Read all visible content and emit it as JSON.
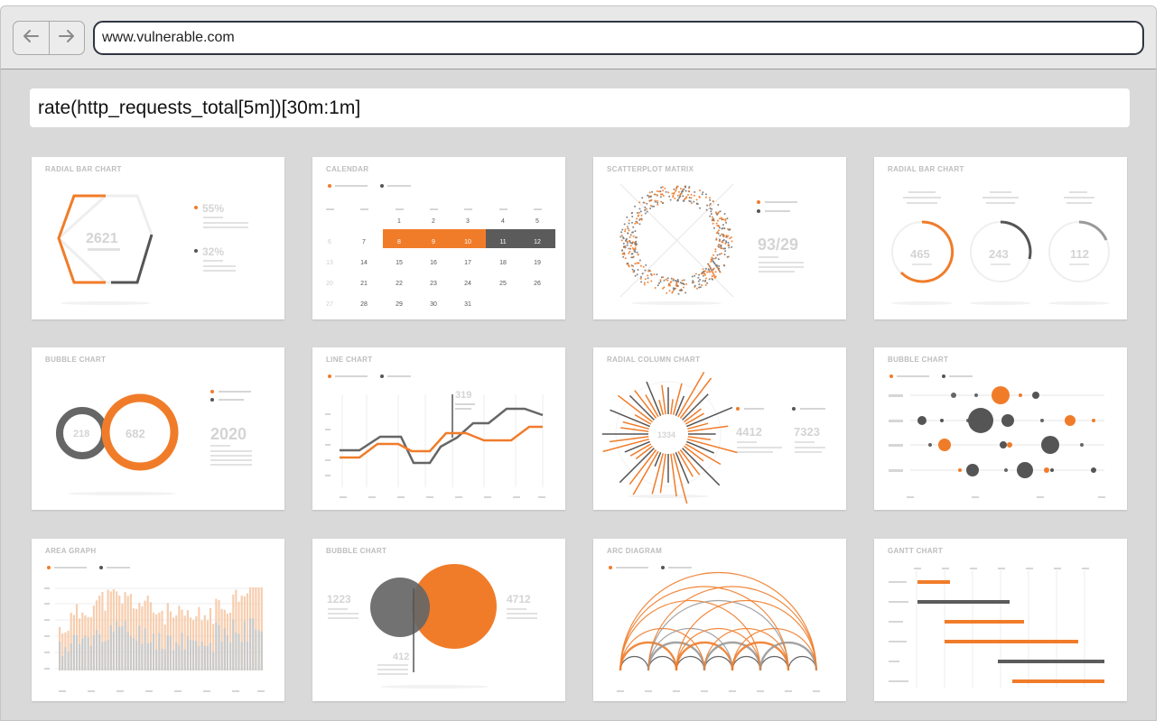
{
  "browser": {
    "url": "www.vulnerable.com",
    "back_icon": "arrow-left-icon",
    "forward_icon": "arrow-right-icon"
  },
  "query": {
    "text": "rate(http_requests_total[5m])[30m:1m]"
  },
  "cards": {
    "radial_bar": {
      "title": "RADIAL BAR CHART",
      "value": "2621",
      "pct1": "55%",
      "pct2": "32%"
    },
    "calendar": {
      "title": "CALENDAR",
      "weeks": [
        [
          "",
          "",
          "1",
          "2",
          "3",
          "4",
          "5"
        ],
        [
          "6",
          "7",
          "8",
          "9",
          "10",
          "11",
          "12"
        ],
        [
          "13",
          "14",
          "15",
          "16",
          "17",
          "18",
          "19"
        ],
        [
          "20",
          "21",
          "22",
          "23",
          "24",
          "25",
          "26"
        ],
        [
          "27",
          "28",
          "29",
          "30",
          "31",
          "",
          ""
        ]
      ]
    },
    "scatterplot": {
      "title": "SCATTERPLOT MATRIX",
      "value": "93/29"
    },
    "radial_bar2": {
      "title": "RADIAL BAR CHART",
      "v1": "465",
      "v2": "243",
      "v3": "112"
    },
    "bubble1": {
      "title": "BUBBLE CHART",
      "v1": "218",
      "v2": "682",
      "v3": "2020"
    },
    "line": {
      "title": "LINE CHART",
      "value": "319"
    },
    "radial_column": {
      "title": "RADIAL COLUMN CHART",
      "center": "1334",
      "v1": "4412",
      "v2": "7323"
    },
    "bubble2": {
      "title": "BUBBLE CHART"
    },
    "area": {
      "title": "AREA GRAPH"
    },
    "bubble3": {
      "title": "BUBBLE CHART",
      "v1": "1223",
      "v2": "4712",
      "v3": "412"
    },
    "arc": {
      "title": "ARC DIAGRAM"
    },
    "gantt": {
      "title": "GANTT CHART"
    }
  },
  "colors": {
    "accent": "#f07c2a",
    "dark": "#555555",
    "light": "#d6d6d6"
  }
}
